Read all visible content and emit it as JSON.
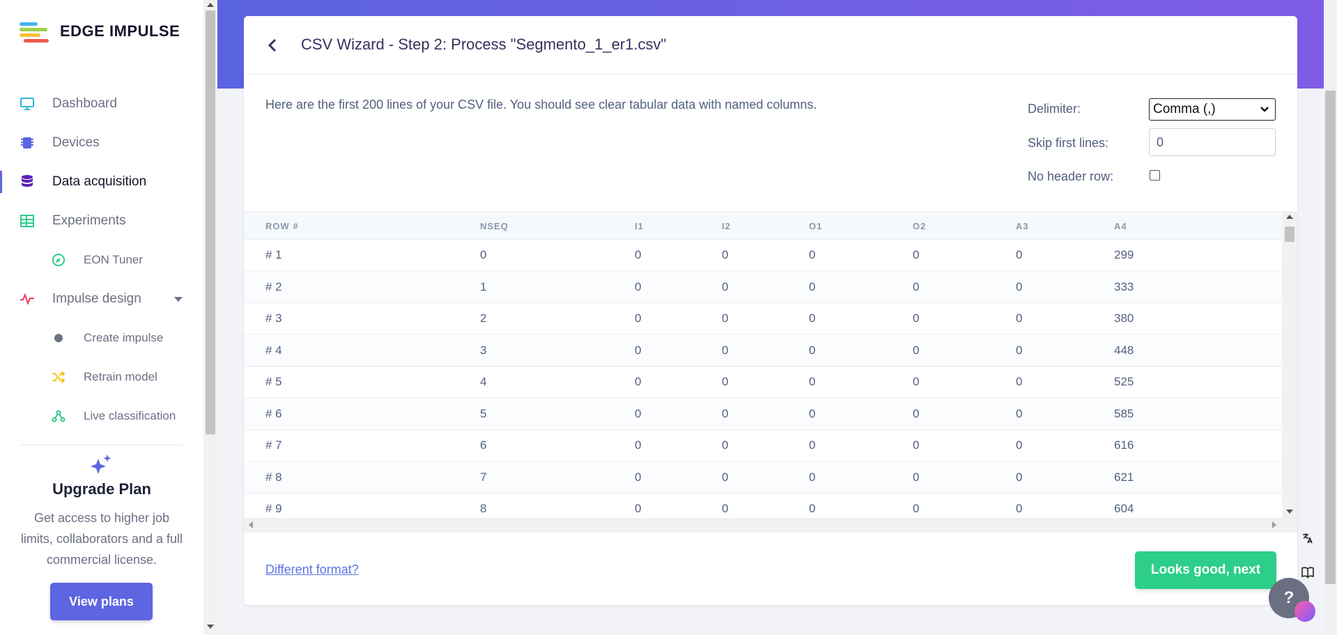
{
  "app": {
    "brand": "EDGE IMPULSE"
  },
  "sidebar": {
    "items": [
      {
        "label": "Dashboard",
        "icon": "monitor-icon"
      },
      {
        "label": "Devices",
        "icon": "chip-icon"
      },
      {
        "label": "Data acquisition",
        "icon": "database-icon",
        "active": true
      },
      {
        "label": "Experiments",
        "icon": "table-icon"
      },
      {
        "label": "EON Tuner",
        "icon": "compass-icon"
      },
      {
        "label": "Impulse design",
        "icon": "pulse-icon"
      },
      {
        "label": "Create impulse",
        "icon": "dot-icon"
      },
      {
        "label": "Retrain model",
        "icon": "shuffle-icon"
      },
      {
        "label": "Live classification",
        "icon": "nodes-icon"
      }
    ],
    "upgrade": {
      "title": "Upgrade Plan",
      "text": "Get access to higher job limits, collaborators and a full commercial license.",
      "button": "View plans"
    }
  },
  "wizard": {
    "title": "CSV Wizard - Step 2: Process \"Segmento_1_er1.csv\"",
    "intro": "Here are the first 200 lines of your CSV file. You should see clear tabular data with named columns.",
    "delimiter_label": "Delimiter:",
    "delimiter_value": "Comma (,)",
    "skip_label": "Skip first lines:",
    "skip_value": "0",
    "noheader_label": "No header row:",
    "different_format": "Different format?",
    "next_button": "Looks good, next"
  },
  "table": {
    "headers": [
      "ROW #",
      "NSEQ",
      "I1",
      "I2",
      "O1",
      "O2",
      "A3",
      "A4"
    ],
    "rows": [
      [
        "# 1",
        "0",
        "0",
        "0",
        "0",
        "0",
        "0",
        "299"
      ],
      [
        "# 2",
        "1",
        "0",
        "0",
        "0",
        "0",
        "0",
        "333"
      ],
      [
        "# 3",
        "2",
        "0",
        "0",
        "0",
        "0",
        "0",
        "380"
      ],
      [
        "# 4",
        "3",
        "0",
        "0",
        "0",
        "0",
        "0",
        "448"
      ],
      [
        "# 5",
        "4",
        "0",
        "0",
        "0",
        "0",
        "0",
        "525"
      ],
      [
        "# 6",
        "5",
        "0",
        "0",
        "0",
        "0",
        "0",
        "585"
      ],
      [
        "# 7",
        "6",
        "0",
        "0",
        "0",
        "0",
        "0",
        "616"
      ],
      [
        "# 8",
        "7",
        "0",
        "0",
        "0",
        "0",
        "0",
        "621"
      ],
      [
        "# 9",
        "8",
        "0",
        "0",
        "0",
        "0",
        "0",
        "604"
      ]
    ]
  },
  "colors": {
    "accent": "#5d65e2",
    "success": "#2dce89",
    "header_gradient_start": "#5a63e0",
    "header_gradient_end": "#7f5ce6"
  }
}
